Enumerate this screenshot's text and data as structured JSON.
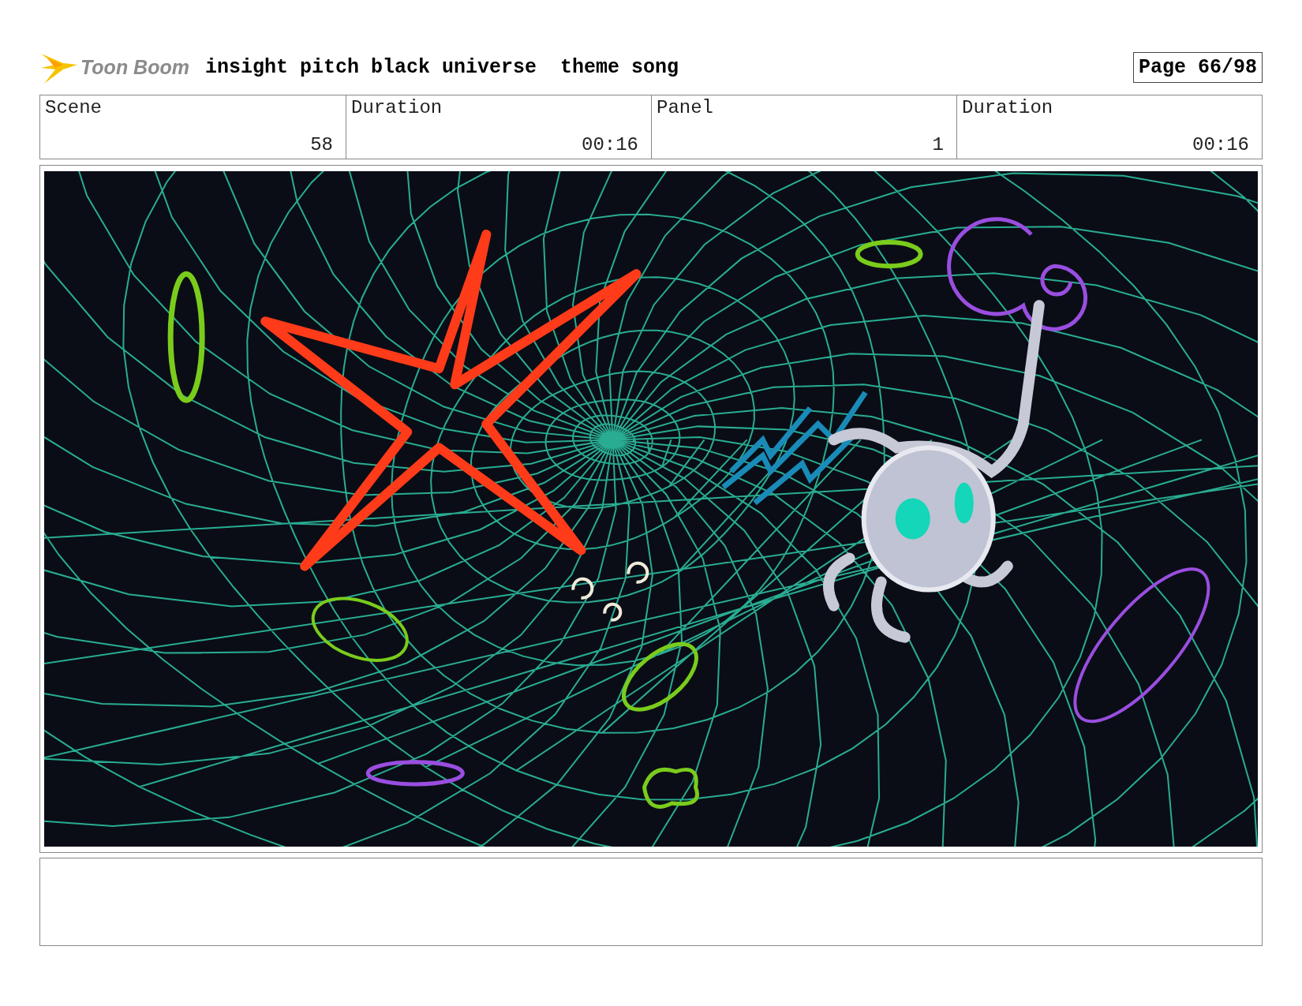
{
  "header": {
    "logo_text": "Toon Boom",
    "title": "insight pitch black universe  theme song",
    "page": "Page 66/98"
  },
  "fields": [
    {
      "label": "Scene",
      "value": "58"
    },
    {
      "label": "Duration",
      "value": "00:16"
    },
    {
      "label": "Panel",
      "value": "1"
    },
    {
      "label": "Duration",
      "value": "00:16"
    }
  ]
}
